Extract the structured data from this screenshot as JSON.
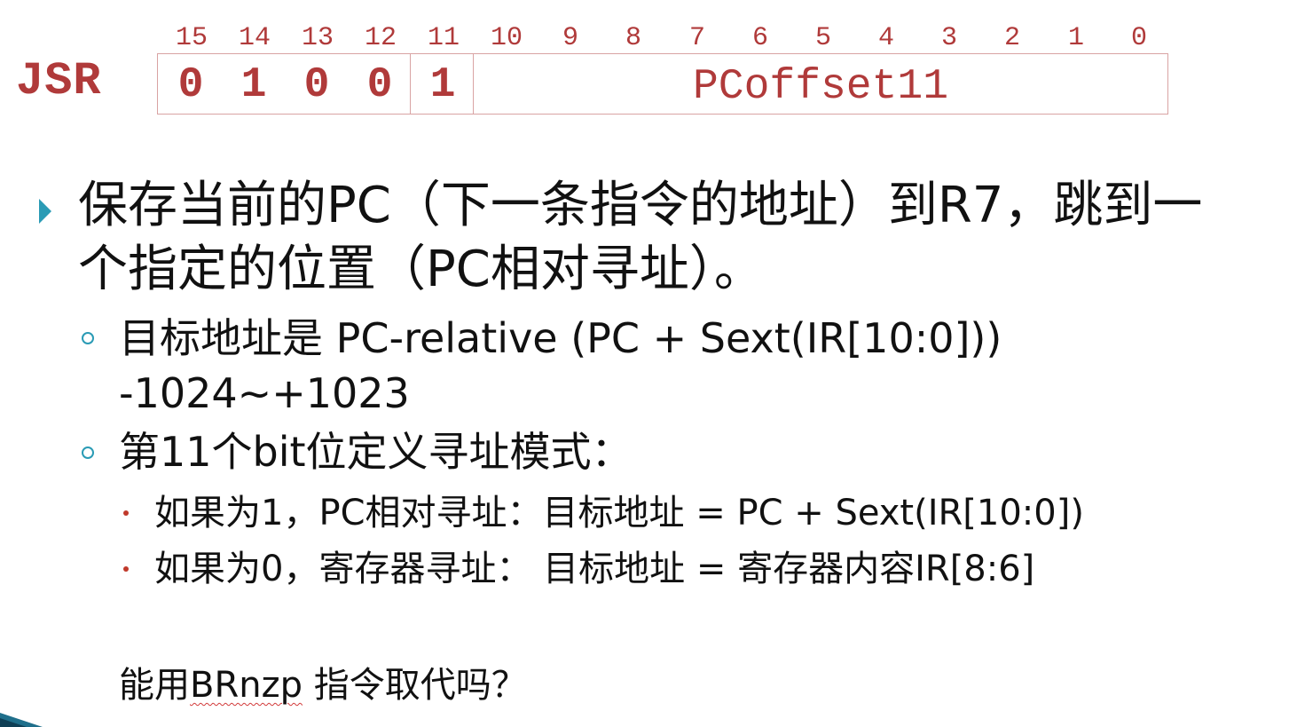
{
  "instruction": {
    "name": "JSR",
    "bit_numbers": [
      "15",
      "14",
      "13",
      "12",
      "11",
      "10",
      "9",
      "8",
      "7",
      "6",
      "5",
      "4",
      "3",
      "2",
      "1",
      "0"
    ],
    "opcode_bits": [
      "0",
      "1",
      "0",
      "0"
    ],
    "mode_bit": "1",
    "offset_field": "PCoffset11"
  },
  "bullets": {
    "main": "保存当前的PC（下一条指令的地址）到R7，跳到一个指定的位置（PC相对寻址）。",
    "sub1": "目标地址是 PC-relative (PC + Sext(IR[10:0]))  -1024~+1023",
    "sub2": "第11个bit位定义寻址模式：",
    "sub2a": "如果为1，PC相对寻址：目标地址 = PC + Sext(IR[10:0])",
    "sub2b": "如果为0，寄存器寻址：  目标地址 = 寄存器内容IR[8:6]"
  },
  "question": {
    "prefix": "能用",
    "highlight": "BRnzp",
    "suffix": " 指令取代吗？"
  },
  "colors": {
    "accent_red": "#b03a3a",
    "bullet_teal": "#2a9bb5",
    "dot_red": "#c0392b",
    "box_border": "#d9a3a3"
  }
}
